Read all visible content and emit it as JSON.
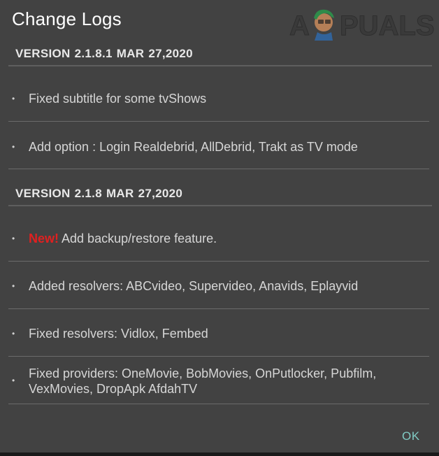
{
  "dialog": {
    "title": "Change Logs",
    "ok_label": "OK",
    "ok_color": "#80cbc4"
  },
  "watermark": {
    "text_left": "A",
    "text_right": "PUALS",
    "icon": "appuals-mascot-logo"
  },
  "sections": [
    {
      "version_label": "VERSION 2.1.8.1  MAR 27,2020",
      "items": [
        {
          "text": "Fixed subtitle for some tvShows"
        },
        {
          "text": "Add option : Login Realdebrid, AllDebrid, Trakt as TV mode"
        }
      ]
    },
    {
      "version_label": "VERSION 2.1.8  MAR 27,2020",
      "items": [
        {
          "badge": "New!",
          "text": " Add backup/restore feature."
        },
        {
          "text": "Added resolvers: ABCvideo, Supervideo, Anavids, Eplayvid"
        },
        {
          "text": "Fixed resolvers: Vidlox, Fembed"
        },
        {
          "text": "Fixed providers: OneMovie, BobMovies, OnPutlocker, Pubfilm, VexMovies, DropApk AfdahTV"
        }
      ]
    }
  ],
  "colors": {
    "background": "#424242",
    "new_badge": "#e02020",
    "text": "#d6d6d6"
  }
}
